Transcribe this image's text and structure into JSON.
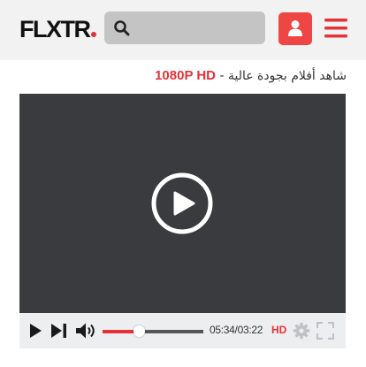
{
  "header": {
    "logo_text": "FLXTR",
    "search_placeholder": "",
    "brand_color": "#e53238"
  },
  "subtitle": {
    "text": "شاهد أفلام بجودة عالية - ",
    "quality": "1080P HD"
  },
  "player": {
    "current_time": "05:34",
    "separator": "/",
    "duration": "03:22",
    "quality_label": "HD",
    "progress_percent": 36
  },
  "icons": {
    "search": "search-icon",
    "user": "user-icon",
    "menu": "hamburger-menu-icon",
    "play": "play-icon",
    "next": "next-icon",
    "volume": "volume-icon",
    "settings": "gear-icon",
    "fullscreen": "fullscreen-icon"
  }
}
